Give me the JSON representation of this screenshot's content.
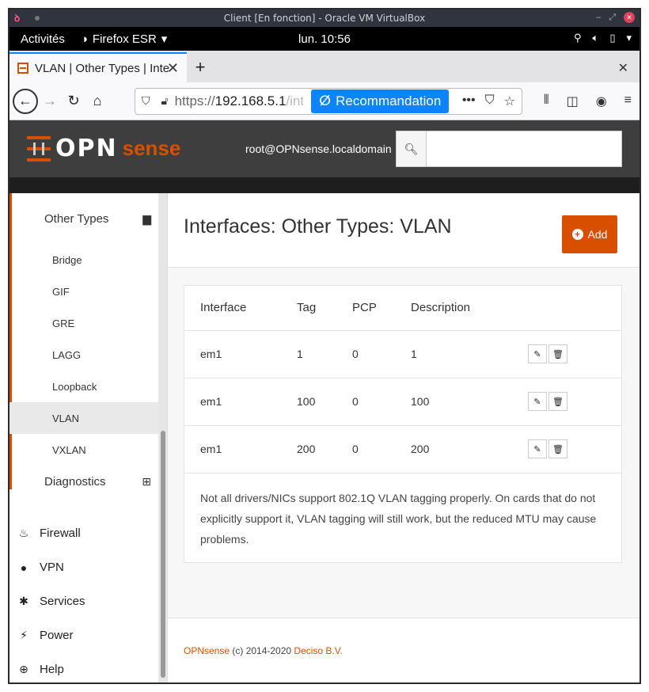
{
  "vm": {
    "title": "Client [En fonction] - Oracle VM VirtualBox"
  },
  "gnome": {
    "activities": "Activités",
    "app_menu": "Firefox ESR",
    "clock": "lun. 10:56"
  },
  "browser": {
    "tab_title": "VLAN | Other Types | Inte",
    "url_scheme": "https://",
    "url_host": "192.168.5.1",
    "url_rest": "/inte",
    "recommend_label": "Recommandation"
  },
  "opn": {
    "logo_opn": "OPN",
    "logo_sense": "sense",
    "user": "root@OPNsense.localdomain",
    "search_placeholder": ""
  },
  "sidebar": {
    "group": "Other Types",
    "sub_items": [
      "Bridge",
      "GIF",
      "GRE",
      "LAGG",
      "Loopback",
      "VLAN",
      "VXLAN"
    ],
    "active": "VLAN",
    "diagnostics": "Diagnostics",
    "top_items": [
      "Firewall",
      "VPN",
      "Services",
      "Power",
      "Help"
    ]
  },
  "page": {
    "title": "Interfaces: Other Types: VLAN",
    "add_label": "Add",
    "columns": [
      "Interface",
      "Tag",
      "PCP",
      "Description"
    ],
    "rows": [
      {
        "interface": "em1",
        "tag": "1",
        "pcp": "0",
        "description": "1"
      },
      {
        "interface": "em1",
        "tag": "100",
        "pcp": "0",
        "description": "100"
      },
      {
        "interface": "em1",
        "tag": "200",
        "pcp": "0",
        "description": "200"
      }
    ],
    "note": "Not all drivers/NICs support 802.1Q VLAN tagging properly. On cards that do not explicitly support it, VLAN tagging will still work, but the reduced MTU may cause problems."
  },
  "footer": {
    "brand": "OPNsense",
    "copy": " (c) 2014-2020 ",
    "company": "Deciso B.V."
  },
  "colors": {
    "accent": "#d94f00",
    "firefox_blue": "#0a84ff",
    "header_bg": "#3e3e3e"
  }
}
